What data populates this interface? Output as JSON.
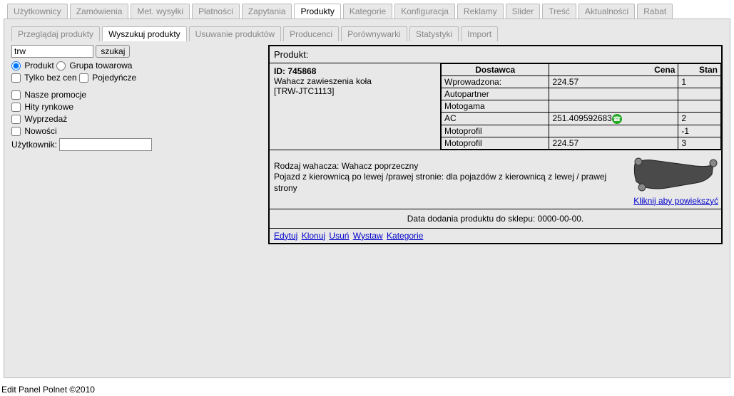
{
  "main_tabs": [
    "Użytkownicy",
    "Zamówienia",
    "Met. wysyłki",
    "Płatności",
    "Zapytania",
    "Produkty",
    "Kategorie",
    "Konfiguracja",
    "Reklamy",
    "Slider",
    "Treść",
    "Aktualności",
    "Rabat"
  ],
  "main_active": 5,
  "sub_tabs": [
    "Przeglądaj produkty",
    "Wyszukuj produkty",
    "Usuwanie produktów",
    "Producenci",
    "Porównywarki",
    "Statystyki",
    "Import"
  ],
  "sub_active": 1,
  "search": {
    "value": "trw",
    "button": "szukaj",
    "radio_product": "Produkt",
    "radio_group": "Grupa towarowa",
    "chk_only_no_price": "Tylko bez cen",
    "chk_single": "Pojedyńcze",
    "chk_promo": "Nasze promocje",
    "chk_hits": "Hity rynkowe",
    "chk_sale": "Wyprzedaż",
    "chk_new": "Nowości",
    "user_label": "Użytkownik:"
  },
  "product": {
    "header": "Produkt:",
    "id_label": "ID: 745868",
    "name": "Wahacz zawieszenia koła",
    "code": "[TRW-JTC1113]",
    "th_supplier": "Dostawca",
    "th_price": "Cena",
    "th_stock": "Stan",
    "rows": [
      {
        "supplier": "Wprowadzona:",
        "price": "224.57",
        "stock": "1"
      },
      {
        "supplier": "Autopartner",
        "price": "",
        "stock": ""
      },
      {
        "supplier": "Motogama",
        "price": "",
        "stock": ""
      },
      {
        "supplier": "AC",
        "price": "251.409592683",
        "stock": "2",
        "phone": true
      },
      {
        "supplier": "Motoprofil",
        "price": "",
        "stock": "-1"
      },
      {
        "supplier": "Motoprofil",
        "price": "224.57",
        "stock": "3"
      }
    ],
    "desc1": "Rodzaj wahacza: Wahacz poprzeczny",
    "desc2": "Pojazd z kierownicą po lewej /prawej stronie: dla pojazdów z kierownicą z lewej / prawej strony",
    "enlarge": "Kliknij aby powiekszyć",
    "date_row": "Data dodania produktu do sklepu: 0000-00-00.",
    "actions": [
      "Edytuj",
      "Klonuj",
      "Usuń",
      "Wystaw",
      "Kategorie"
    ]
  },
  "footer": "Edit Panel Polnet ©2010"
}
